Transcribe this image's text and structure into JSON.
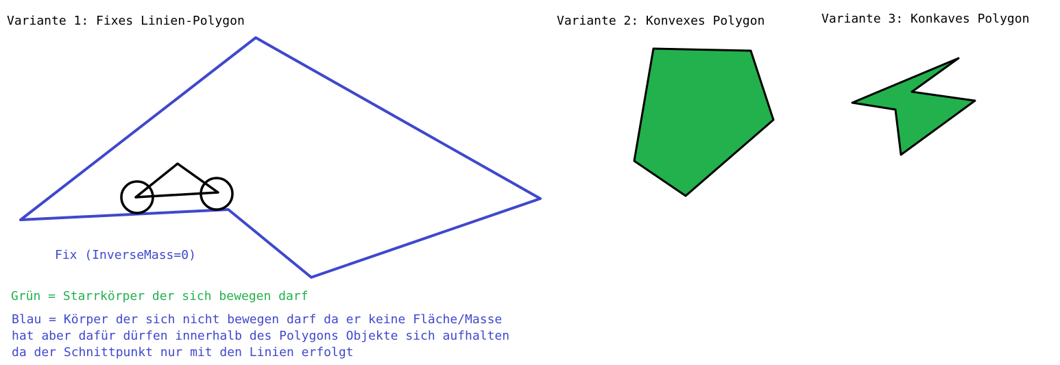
{
  "variants": [
    {
      "title": "Variante 1: Fixes Linien-Polygon"
    },
    {
      "title": "Variante 2: Konvexes Polygon"
    },
    {
      "title": "Variante 3: Konkaves Polygon"
    }
  ],
  "fixed_polygon_label": "Fix (InverseMass=0)",
  "legend": {
    "green": "Grün = Starrkörper der sich bewegen darf",
    "blue_line1": "Blau = Körper der sich nicht bewegen darf da er keine Fläche/Masse",
    "blue_line2": "hat aber dafür dürfen innerhalb des Polygons Objekte sich aufhalten",
    "blue_line3": "da der Schnittpunkt nur mit den Linien erfolgt"
  },
  "colors": {
    "blue": "#3f48cc",
    "green": "#22b14c",
    "black": "#000000",
    "text": "#000000"
  }
}
